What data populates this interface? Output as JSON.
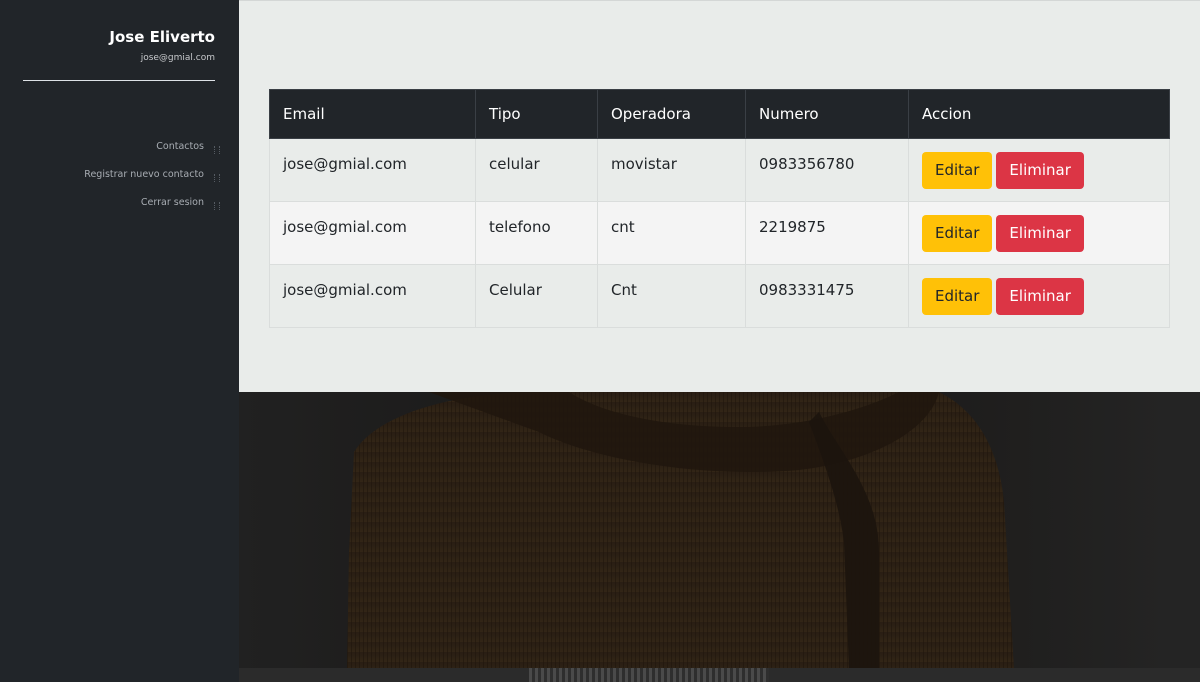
{
  "user": {
    "name": "Jose Eliverto",
    "email": "jose@gmial.com"
  },
  "nav": {
    "items": [
      {
        "label": "Contactos"
      },
      {
        "label": "Registrar nuevo contacto"
      },
      {
        "label": "Cerrar sesion"
      }
    ]
  },
  "table": {
    "headers": [
      "Email",
      "Tipo",
      "Operadora",
      "Numero",
      "Accion"
    ],
    "rows": [
      {
        "email": "jose@gmial.com",
        "tipo": "celular",
        "operadora": "movistar",
        "numero": "0983356780"
      },
      {
        "email": "jose@gmial.com",
        "tipo": "telefono",
        "operadora": "cnt",
        "numero": "2219875"
      },
      {
        "email": "jose@gmial.com",
        "tipo": "Celular",
        "operadora": "Cnt",
        "numero": "0983331475"
      }
    ],
    "edit_label": "Editar",
    "delete_label": "Eliminar"
  },
  "colors": {
    "sidebar": "#212529",
    "panel": "#e9ecea",
    "table_header": "#212529",
    "edit_button": "#ffc107",
    "delete_button": "#dc3545"
  }
}
